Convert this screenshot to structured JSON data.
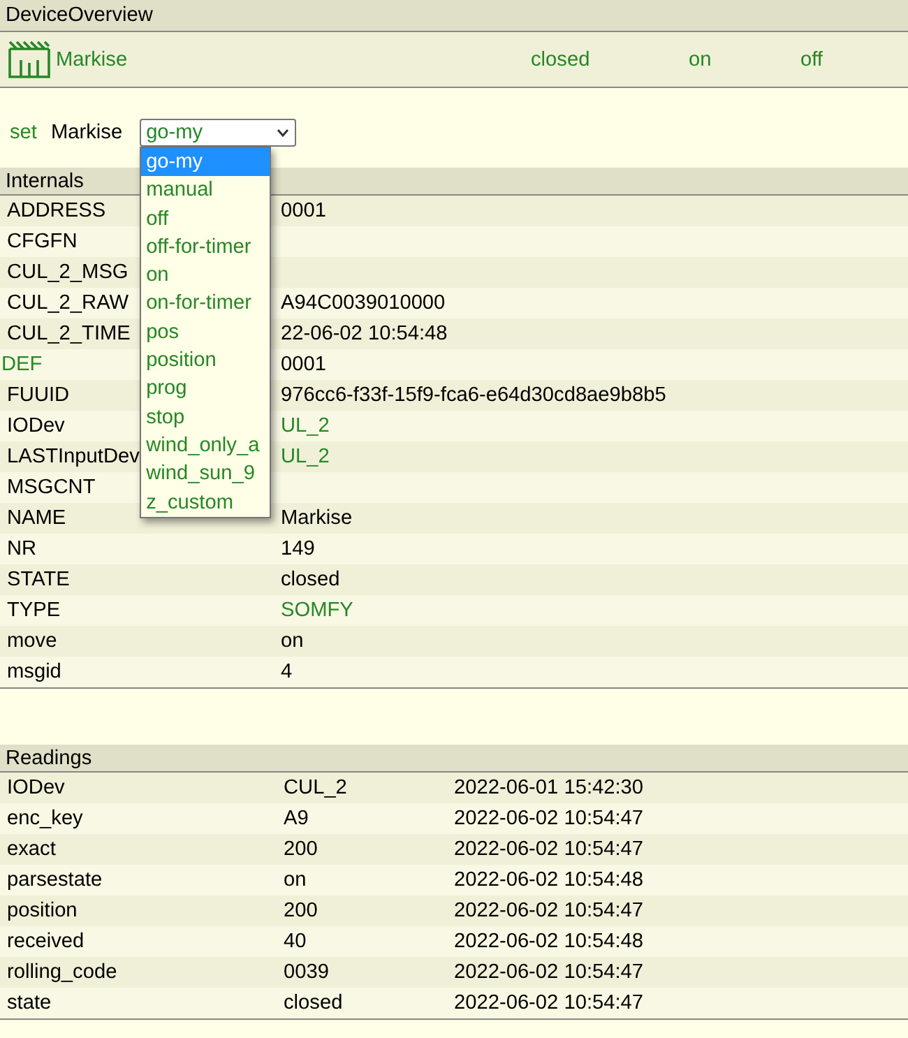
{
  "device_overview": {
    "title": "DeviceOverview",
    "device": {
      "name": "Markise",
      "states": [
        "closed",
        "on",
        "off"
      ]
    }
  },
  "set_command": {
    "label": "set",
    "device": "Markise",
    "value": "go-my",
    "options": [
      {
        "label": "go-my",
        "selected": true
      },
      {
        "label": "manual",
        "selected": false
      },
      {
        "label": "off",
        "selected": false
      },
      {
        "label": "off-for-timer",
        "selected": false
      },
      {
        "label": "on",
        "selected": false
      },
      {
        "label": "on-for-timer",
        "selected": false
      },
      {
        "label": "pos",
        "selected": false
      },
      {
        "label": "position",
        "selected": false
      },
      {
        "label": "prog",
        "selected": false
      },
      {
        "label": "stop",
        "selected": false
      },
      {
        "label": "wind_only_a",
        "selected": false
      },
      {
        "label": "wind_sun_9",
        "selected": false
      },
      {
        "label": "z_custom",
        "selected": false
      }
    ]
  },
  "internals": {
    "title": "Internals",
    "rows": [
      {
        "name": "ADDRESS",
        "value": "0001",
        "name_link": false,
        "value_link": false
      },
      {
        "name": "CFGFN",
        "name_link": false
      },
      {
        "name": "CUL_2_MSG",
        "name_link": false
      },
      {
        "name": "CUL_2_RAW",
        "value": "A94C0039010000",
        "name_link": false,
        "value_link": false
      },
      {
        "name": "CUL_2_TIME",
        "value": "22-06-02 10:54:48",
        "name_link": false,
        "value_link": false
      },
      {
        "name": "DEF",
        "value": "0001",
        "name_link": true,
        "value_link": false
      },
      {
        "name": "FUUID",
        "value": "976cc6-f33f-15f9-fca6-e64d30cd8ae9b8b5",
        "name_link": false,
        "value_link": false
      },
      {
        "name": "IODev",
        "value": "UL_2",
        "name_link": false,
        "value_link": true
      },
      {
        "name": "LASTInputDev",
        "value": "UL_2",
        "name_link": false,
        "value_link": true
      },
      {
        "name": "MSGCNT",
        "name_link": false
      },
      {
        "name": "NAME",
        "value": "Markise",
        "name_link": false,
        "value_link": false
      },
      {
        "name": "NR",
        "value": "149",
        "name_link": false,
        "value_link": false
      },
      {
        "name": "STATE",
        "value": "closed",
        "name_link": false,
        "value_link": false
      },
      {
        "name": "TYPE",
        "value": "SOMFY",
        "name_link": false,
        "value_link": true
      },
      {
        "name": "move",
        "value": "on",
        "name_link": false,
        "value_link": false
      },
      {
        "name": "msgid",
        "value": "4",
        "name_link": false,
        "value_link": false
      }
    ]
  },
  "readings": {
    "title": "Readings",
    "rows": [
      {
        "name": "IODev",
        "value": "CUL_2",
        "time": "2022-06-01 15:42:30"
      },
      {
        "name": "enc_key",
        "value": "A9",
        "time": "2022-06-02 10:54:47"
      },
      {
        "name": "exact",
        "value": "200",
        "time": "2022-06-02 10:54:47"
      },
      {
        "name": "parsestate",
        "value": "on",
        "time": "2022-06-02 10:54:48"
      },
      {
        "name": "position",
        "value": "200",
        "time": "2022-06-02 10:54:47"
      },
      {
        "name": "received",
        "value": "40",
        "time": "2022-06-02 10:54:48"
      },
      {
        "name": "rolling_code",
        "value": "0039",
        "time": "2022-06-02 10:54:47"
      },
      {
        "name": "state",
        "value": "closed",
        "time": "2022-06-02 10:54:47"
      }
    ]
  }
}
